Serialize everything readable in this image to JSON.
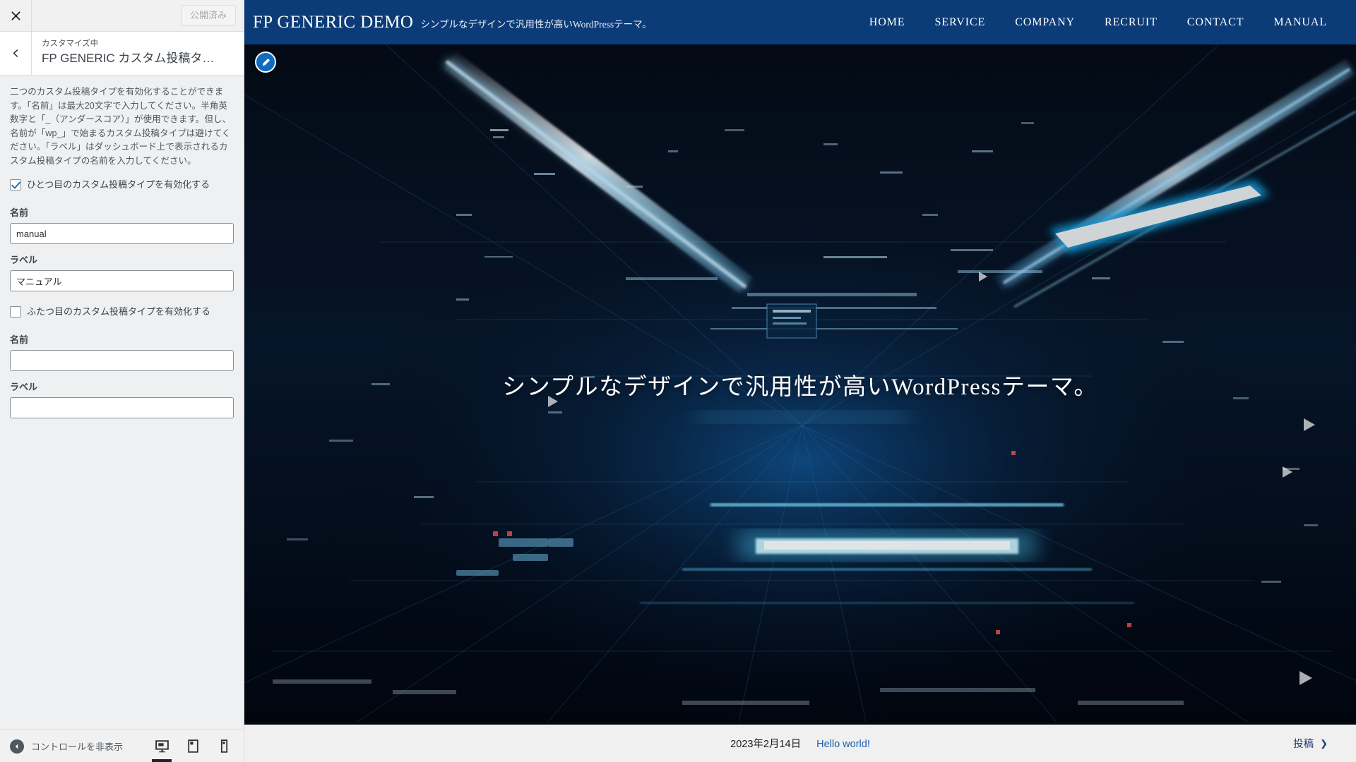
{
  "customizer": {
    "close_label": "×",
    "publish_button": "公開済み",
    "back_label": "‹",
    "eyebrow": "カスタマイズ中",
    "panel_title": "FP GENERIC カスタム投稿タ…",
    "description": "二つのカスタム投稿タイプを有効化することができます。「名前」は最大20文字で入力してください。半角英数字と「_（アンダースコア）」が使用できます。但し、名前が「wp_」で始まるカスタム投稿タイプは避けてください。「ラベル」はダッシュボード上で表示されるカスタム投稿タイプの名前を入力してください。",
    "groups": [
      {
        "checkbox_label": "ひとつ目のカスタム投稿タイプを有効化する",
        "checked": true,
        "name_label": "名前",
        "name_value": "manual",
        "label_label": "ラベル",
        "label_value": "マニュアル"
      },
      {
        "checkbox_label": "ふたつ目のカスタム投稿タイプを有効化する",
        "checked": false,
        "name_label": "名前",
        "name_value": "",
        "label_label": "ラベル",
        "label_value": ""
      }
    ],
    "footer": {
      "collapse_label": "コントロールを非表示",
      "devices": [
        {
          "name": "desktop",
          "active": true
        },
        {
          "name": "tablet",
          "active": false
        },
        {
          "name": "mobile",
          "active": false
        }
      ]
    }
  },
  "preview": {
    "edit_shortcut": "edit-pencil-icon",
    "header": {
      "site_title": "FP GENERIC DEMO",
      "tagline": "シンプルなデザインで汎用性が高いWordPressテーマ。",
      "nav": [
        {
          "label": "HOME"
        },
        {
          "label": "SERVICE"
        },
        {
          "label": "COMPANY"
        },
        {
          "label": "RECRUIT"
        },
        {
          "label": "CONTACT"
        },
        {
          "label": "MANUAL"
        }
      ]
    },
    "hero": {
      "catchphrase": "シンプルなデザインで汎用性が高いWordPressテーマ。"
    },
    "post_strip": {
      "date": "2023年2月14日",
      "post_title": "Hello world!",
      "more_label": "投稿",
      "more_chevron": "❯"
    }
  },
  "colors": {
    "header_blue": "#0c3c78",
    "link_blue": "#1a5fa8",
    "accent_blue": "#2271b1",
    "sidebar_bg": "#eff0f1"
  }
}
